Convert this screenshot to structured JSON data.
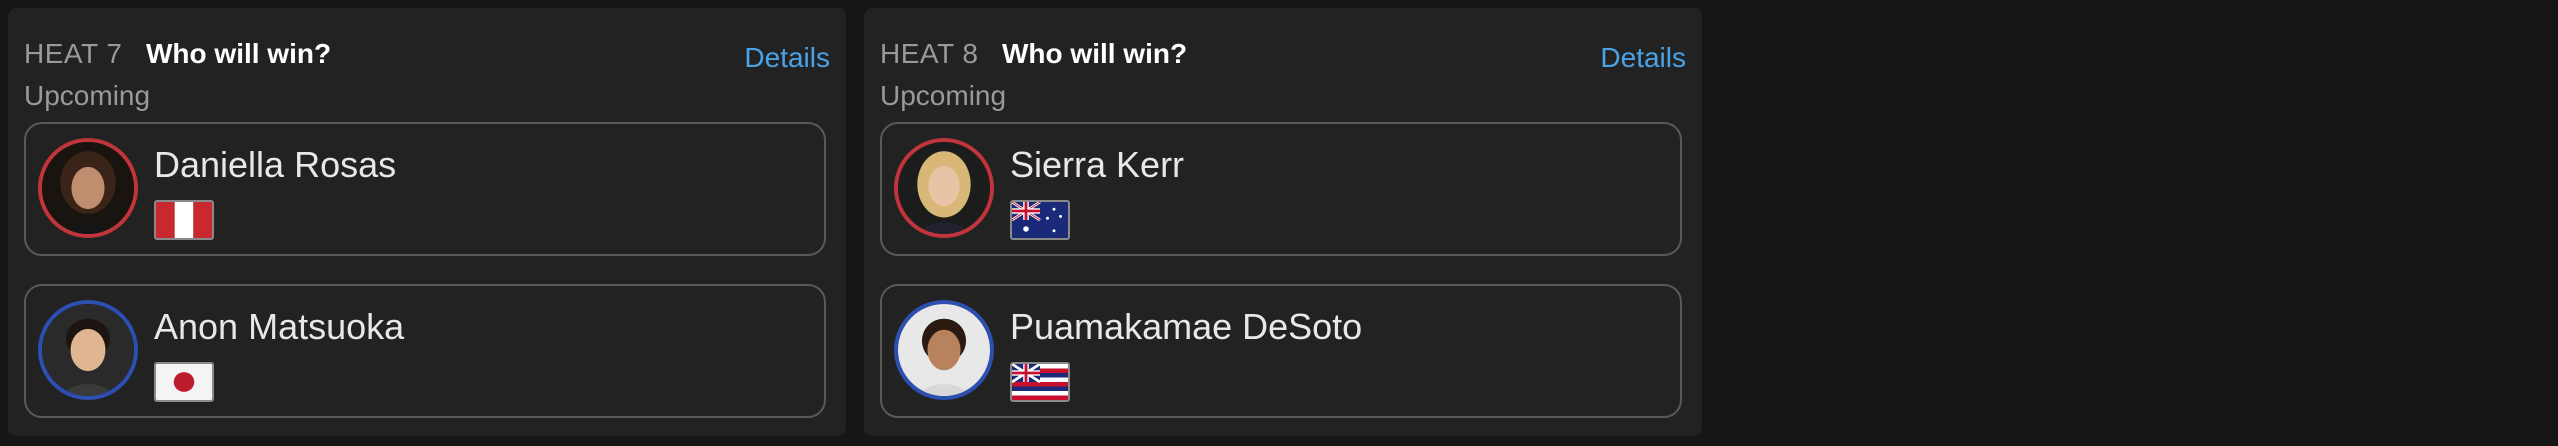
{
  "heats": [
    {
      "heat_label": "HEAT 7",
      "question": "Who will win?",
      "details_label": "Details",
      "status": "Upcoming",
      "surfers": [
        {
          "name": "Daniella Rosas",
          "flag": "peru-flag-icon",
          "ring_color": "#c0343b"
        },
        {
          "name": "Anon Matsuoka",
          "flag": "japan-flag-icon",
          "ring_color": "#2c4fb2"
        }
      ]
    },
    {
      "heat_label": "HEAT 8",
      "question": "Who will win?",
      "details_label": "Details",
      "status": "Upcoming",
      "surfers": [
        {
          "name": "Sierra Kerr",
          "flag": "australia-flag-icon",
          "ring_color": "#c0343b"
        },
        {
          "name": "Puamakamae DeSoto",
          "flag": "hawaii-flag-icon",
          "ring_color": "#2c4fb2"
        }
      ]
    }
  ],
  "colors": {
    "background": "#161616",
    "card": "#222222",
    "link": "#4aa3e6",
    "red_jersey": "#c0343b",
    "blue_jersey": "#2c4fb2"
  }
}
